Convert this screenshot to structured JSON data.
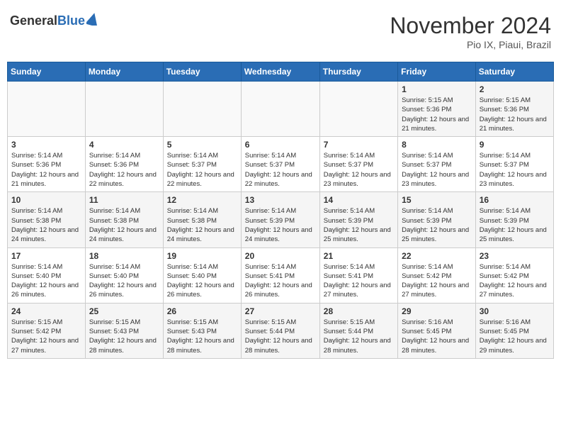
{
  "header": {
    "logo_general": "General",
    "logo_blue": "Blue",
    "month_title": "November 2024",
    "subtitle": "Pio IX, Piaui, Brazil"
  },
  "days_of_week": [
    "Sunday",
    "Monday",
    "Tuesday",
    "Wednesday",
    "Thursday",
    "Friday",
    "Saturday"
  ],
  "weeks": [
    [
      {
        "day": "",
        "info": ""
      },
      {
        "day": "",
        "info": ""
      },
      {
        "day": "",
        "info": ""
      },
      {
        "day": "",
        "info": ""
      },
      {
        "day": "",
        "info": ""
      },
      {
        "day": "1",
        "info": "Sunrise: 5:15 AM\nSunset: 5:36 PM\nDaylight: 12 hours and 21 minutes."
      },
      {
        "day": "2",
        "info": "Sunrise: 5:15 AM\nSunset: 5:36 PM\nDaylight: 12 hours and 21 minutes."
      }
    ],
    [
      {
        "day": "3",
        "info": "Sunrise: 5:14 AM\nSunset: 5:36 PM\nDaylight: 12 hours and 21 minutes."
      },
      {
        "day": "4",
        "info": "Sunrise: 5:14 AM\nSunset: 5:36 PM\nDaylight: 12 hours and 22 minutes."
      },
      {
        "day": "5",
        "info": "Sunrise: 5:14 AM\nSunset: 5:37 PM\nDaylight: 12 hours and 22 minutes."
      },
      {
        "day": "6",
        "info": "Sunrise: 5:14 AM\nSunset: 5:37 PM\nDaylight: 12 hours and 22 minutes."
      },
      {
        "day": "7",
        "info": "Sunrise: 5:14 AM\nSunset: 5:37 PM\nDaylight: 12 hours and 23 minutes."
      },
      {
        "day": "8",
        "info": "Sunrise: 5:14 AM\nSunset: 5:37 PM\nDaylight: 12 hours and 23 minutes."
      },
      {
        "day": "9",
        "info": "Sunrise: 5:14 AM\nSunset: 5:37 PM\nDaylight: 12 hours and 23 minutes."
      }
    ],
    [
      {
        "day": "10",
        "info": "Sunrise: 5:14 AM\nSunset: 5:38 PM\nDaylight: 12 hours and 24 minutes."
      },
      {
        "day": "11",
        "info": "Sunrise: 5:14 AM\nSunset: 5:38 PM\nDaylight: 12 hours and 24 minutes."
      },
      {
        "day": "12",
        "info": "Sunrise: 5:14 AM\nSunset: 5:38 PM\nDaylight: 12 hours and 24 minutes."
      },
      {
        "day": "13",
        "info": "Sunrise: 5:14 AM\nSunset: 5:39 PM\nDaylight: 12 hours and 24 minutes."
      },
      {
        "day": "14",
        "info": "Sunrise: 5:14 AM\nSunset: 5:39 PM\nDaylight: 12 hours and 25 minutes."
      },
      {
        "day": "15",
        "info": "Sunrise: 5:14 AM\nSunset: 5:39 PM\nDaylight: 12 hours and 25 minutes."
      },
      {
        "day": "16",
        "info": "Sunrise: 5:14 AM\nSunset: 5:39 PM\nDaylight: 12 hours and 25 minutes."
      }
    ],
    [
      {
        "day": "17",
        "info": "Sunrise: 5:14 AM\nSunset: 5:40 PM\nDaylight: 12 hours and 26 minutes."
      },
      {
        "day": "18",
        "info": "Sunrise: 5:14 AM\nSunset: 5:40 PM\nDaylight: 12 hours and 26 minutes."
      },
      {
        "day": "19",
        "info": "Sunrise: 5:14 AM\nSunset: 5:40 PM\nDaylight: 12 hours and 26 minutes."
      },
      {
        "day": "20",
        "info": "Sunrise: 5:14 AM\nSunset: 5:41 PM\nDaylight: 12 hours and 26 minutes."
      },
      {
        "day": "21",
        "info": "Sunrise: 5:14 AM\nSunset: 5:41 PM\nDaylight: 12 hours and 27 minutes."
      },
      {
        "day": "22",
        "info": "Sunrise: 5:14 AM\nSunset: 5:42 PM\nDaylight: 12 hours and 27 minutes."
      },
      {
        "day": "23",
        "info": "Sunrise: 5:14 AM\nSunset: 5:42 PM\nDaylight: 12 hours and 27 minutes."
      }
    ],
    [
      {
        "day": "24",
        "info": "Sunrise: 5:15 AM\nSunset: 5:42 PM\nDaylight: 12 hours and 27 minutes."
      },
      {
        "day": "25",
        "info": "Sunrise: 5:15 AM\nSunset: 5:43 PM\nDaylight: 12 hours and 28 minutes."
      },
      {
        "day": "26",
        "info": "Sunrise: 5:15 AM\nSunset: 5:43 PM\nDaylight: 12 hours and 28 minutes."
      },
      {
        "day": "27",
        "info": "Sunrise: 5:15 AM\nSunset: 5:44 PM\nDaylight: 12 hours and 28 minutes."
      },
      {
        "day": "28",
        "info": "Sunrise: 5:15 AM\nSunset: 5:44 PM\nDaylight: 12 hours and 28 minutes."
      },
      {
        "day": "29",
        "info": "Sunrise: 5:16 AM\nSunset: 5:45 PM\nDaylight: 12 hours and 28 minutes."
      },
      {
        "day": "30",
        "info": "Sunrise: 5:16 AM\nSunset: 5:45 PM\nDaylight: 12 hours and 29 minutes."
      }
    ]
  ]
}
